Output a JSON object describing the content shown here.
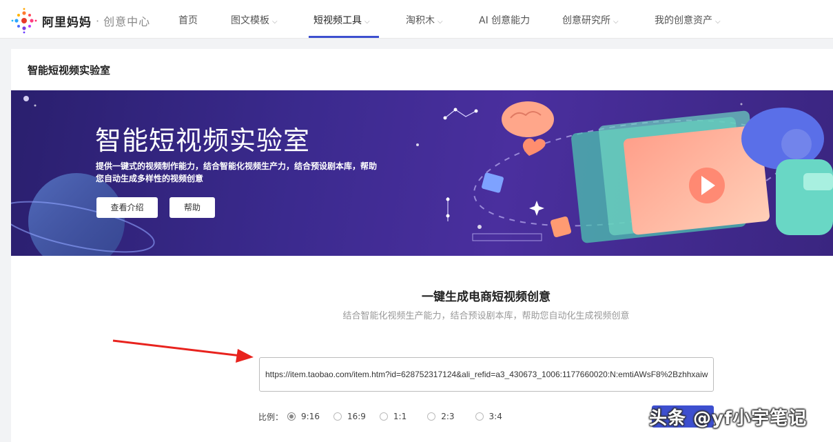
{
  "brand": {
    "name": "阿里妈妈",
    "separator": "·",
    "product": "创意中心"
  },
  "nav": {
    "items": [
      {
        "label": "首页",
        "has_dropdown": false,
        "active": false
      },
      {
        "label": "图文模板",
        "has_dropdown": true,
        "active": false
      },
      {
        "label": "短视频工具",
        "has_dropdown": true,
        "active": true
      },
      {
        "label": "淘积木",
        "has_dropdown": true,
        "active": false
      },
      {
        "label": "AI 创意能力",
        "has_dropdown": false,
        "active": false
      },
      {
        "label": "创意研究所",
        "has_dropdown": true,
        "active": false
      },
      {
        "label": "我的创意资产",
        "has_dropdown": true,
        "active": false
      }
    ],
    "chevron": "⌵"
  },
  "page": {
    "title": "智能短视频实验室"
  },
  "banner": {
    "title": "智能短视频实验室",
    "description": "提供一键式的视频制作能力，结合智能化视频生产力，结合预设剧本库，帮助您自动生成多样性的视频创意",
    "buttons": [
      {
        "label": "查看介绍"
      },
      {
        "label": "帮助"
      }
    ]
  },
  "generator": {
    "title": "一键生成电商短视频创意",
    "subtitle": "结合智能化视频生产能力，结合预设剧本库，帮助您自动化生成视频创意",
    "url_value": "https://item.taobao.com/item.htm?id=628752317124&ali_refid=a3_430673_1006:1177660020:N:emtiAWsF8%2Bzhhxaiw",
    "ratio_label": "比例：",
    "ratios": [
      {
        "label": "9:16",
        "checked": true
      },
      {
        "label": "16:9",
        "checked": false
      },
      {
        "label": "1:1",
        "checked": false
      },
      {
        "label": "2:3",
        "checked": false
      },
      {
        "label": "3:4",
        "checked": false
      }
    ]
  },
  "watermark": "头条 @yf小宇笔记",
  "colors": {
    "accent": "#3d4fcf",
    "banner_bg": "#3b2a8e",
    "arrow": "#e8231e"
  }
}
